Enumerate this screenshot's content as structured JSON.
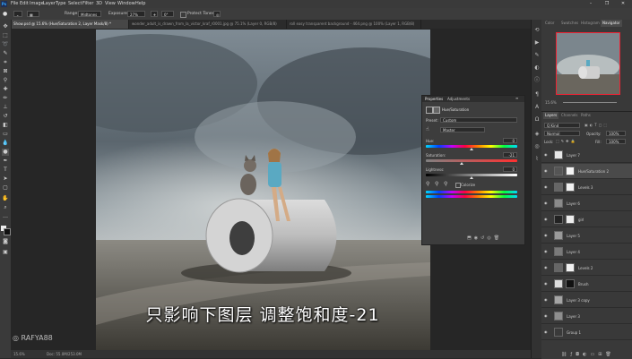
{
  "app": {
    "logo": "Ps"
  },
  "menu": [
    "File",
    "Edit",
    "Image",
    "Layer",
    "Type",
    "Select",
    "Filter",
    "3D",
    "View",
    "Window",
    "Help"
  ],
  "window_controls": [
    "–",
    "❐",
    "✕"
  ],
  "options": {
    "range_label": "Range:",
    "range_value": "Midtones",
    "exposure_label": "Exposure:",
    "exposure_value": "27%",
    "angle_value": "0°",
    "protect_label": "Protect Tones"
  },
  "tabs": [
    {
      "label": "Show.psd @ 15.6% (Hue/Saturation 2, Layer Mask/8) *",
      "active": true
    },
    {
      "label": "wonder_adult_is_drawn_from_la_victor_kraf_r0001.jpg @ 75.1% (Layer 0, RGB/8)",
      "active": false
    },
    {
      "label": "roll easy transparent background - 464.png @ 100% (Layer 1, RGB/8)",
      "active": false
    }
  ],
  "subtitle": "只影响下图层  调整饱和度-21",
  "watermark": "RAFYA88",
  "status": {
    "zoom": "15.6%",
    "doc": "Doc: 55.0M/253.0M"
  },
  "properties": {
    "tabs": [
      "Properties",
      "Adjustments"
    ],
    "title": "Hue/Saturation",
    "preset_label": "Preset:",
    "preset_value": "Custom",
    "channel_value": "Master",
    "hue_label": "Hue:",
    "hue_value": "0",
    "saturation_label": "Saturation:",
    "saturation_value": "-21",
    "lightness_label": "Lightness:",
    "lightness_value": "0",
    "colorize_label": "Colorize",
    "saturation_level": -21
  },
  "navigator": {
    "tabs": [
      "Color",
      "Swatches",
      "Histogram",
      "Navigator"
    ]
  },
  "layers_panel": {
    "tabs": [
      "Layers",
      "Channels",
      "Paths"
    ],
    "kind_label": "Q Kind",
    "blend_mode": "Normal",
    "opacity_label": "Opacity:",
    "opacity_value": "100%",
    "lock_label": "Lock:",
    "fill_label": "Fill:",
    "fill_value": "100%",
    "rows": [
      {
        "name": "Layer 7",
        "thumb": "#e8e8e8",
        "mask": "",
        "clip": false
      },
      {
        "name": "Hue/Saturation 2",
        "thumb": "#555555",
        "mask": "#f5f5f5",
        "clip": true
      },
      {
        "name": "Levels 3",
        "thumb": "#666666",
        "mask": "#f2f2f2",
        "clip": true
      },
      {
        "name": "Layer 6",
        "thumb": "#8a8a8a",
        "mask": "",
        "clip": false
      },
      {
        "name": "girl",
        "thumb": "#222222",
        "mask": "#eeeeee",
        "clip": false
      },
      {
        "name": "Layer 5",
        "thumb": "#9a9a9a",
        "mask": "",
        "clip": false
      },
      {
        "name": "Layer 4",
        "thumb": "#7a7a7a",
        "mask": "",
        "clip": false
      },
      {
        "name": "Levels 2",
        "thumb": "#666666",
        "mask": "#f2f2f2",
        "clip": true
      },
      {
        "name": "Brush",
        "thumb": "#dddddd",
        "mask": "#111111",
        "clip": false
      },
      {
        "name": "Layer 3 copy",
        "thumb": "#a5a5a5",
        "mask": "",
        "clip": false
      },
      {
        "name": "Layer 3",
        "thumb": "#8e8e8e",
        "mask": "",
        "clip": false
      },
      {
        "name": "Group 1",
        "thumb": "#3a3a3a",
        "mask": "",
        "clip": false
      }
    ]
  },
  "colors": {
    "accent": "#31a8ff",
    "selected_row": "#4a4a4a",
    "panel_bg": "#393939"
  }
}
